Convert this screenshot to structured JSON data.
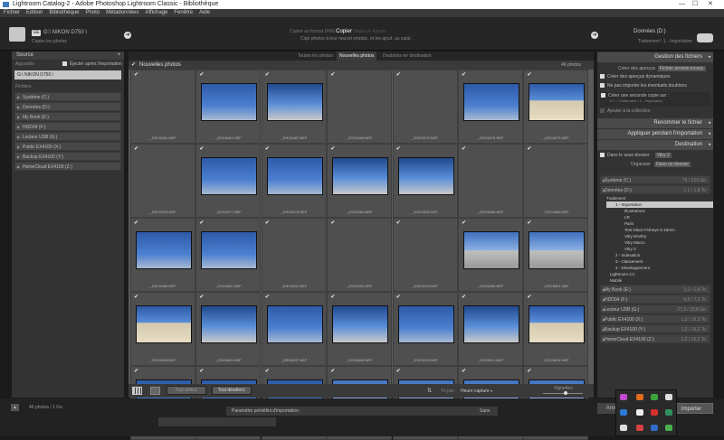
{
  "window": {
    "title": "Lightroom Catalog-2 - Adobe Photoshop Lightroom Classic - Bibliothèque"
  },
  "menu": [
    "Fichier",
    "Edition",
    "Bibliothèque",
    "Photo",
    "Métadonnées",
    "Affichage",
    "Fenêtre",
    "Aide"
  ],
  "import_header": {
    "source_badge": "GE",
    "source_path": "G:\\ NIKON D750 \\",
    "source_sub": "Copier les photos",
    "mode_options": [
      "Copier au format DNG",
      "Copier",
      "Déplacer",
      "Ajouter"
    ],
    "active_mode": "Copier",
    "mode_desc": "Copi photos à leur nouvel emplac. et les ajout. au catal.",
    "dest_label": "Données (D:)",
    "dest_sub": "Traitement \\ 1 - Importation"
  },
  "left_panel": {
    "title": "Source",
    "devices_label": "Appareils",
    "eject_label": "Éjecter après l'importation",
    "selected_device": "G:\\ NIKON D750 \\",
    "files_label": "Fichiers",
    "volumes": [
      "Système (C:)",
      "Données (D:)",
      "My Book (E:)",
      "HDD04 (F:)",
      "Lecteur USB (G:)",
      "Public EX4100 (X:)",
      "Backup EX4100 (Y:)",
      "HomeCloud EX4100 (Z:)"
    ]
  },
  "tabs": [
    "Toutes les photos",
    "Nouvelles photos",
    "Doublons en destination"
  ],
  "active_tab": "Nouvelles photos",
  "grid": {
    "header": "Nouvelles photos",
    "count": "46 photos",
    "files": [
      [
        "_DSC6462.NEF",
        "_DSC6464.NEF",
        "_DSC6467.NEF",
        "_DSC6468.NEF",
        "_DSC6470.NEF",
        "_DSC6473.NEF",
        "_DSC6475.NEF"
      ],
      [
        "_DSC6476.NEF",
        "_DSC6477.NEF",
        "_DSC6479.NEF",
        "_DSC6480.NEF",
        "_DSC6482.NEF",
        "_DSC6484.NEF",
        "_DSC6485.NEF"
      ],
      [
        "_DSC6488.NEF",
        "_DSC6490.NEF",
        "_DSC6491.NEF",
        "_DSC6492.NEF",
        "_DSC6493.NEF",
        "_DSC6496.NEF",
        "_DSC6501.NEF"
      ],
      [
        "_DSC6503.NEF",
        "_DSC6505.NEF",
        "_DSC6507.NEF",
        "_DSC6508.NEF",
        "_DSC6510.NEF",
        "_DSC6511.NEF",
        "_DSC6514.NEF"
      ],
      [
        "",
        "",
        "",
        "",
        "",
        "",
        ""
      ]
    ]
  },
  "toolbar": {
    "check_all": "Tout sélect.",
    "uncheck_all": "Tout désélect.",
    "sort_label": "Tri par :",
    "sort_value": "Heure capture",
    "thumbs_label": "Vignettes"
  },
  "right_panel": {
    "file_handling": "Gestion des fichiers",
    "build_previews_label": "Créer des aperçus",
    "build_previews_value": "Fichier annexe incorp.",
    "smart_previews": "Créer des aperçus dynamiques",
    "no_duplicates": "Ne pas importer les éventuels doublons",
    "second_copy": "Créer une seconde copie sur :",
    "second_copy_path": "E:\\...\\ Traitement \\ 1 - Importation",
    "add_collection": "Ajouter à la collection",
    "rename": "Renommer le fichier",
    "apply": "Appliquer pendant l'importation",
    "destination": "Destination",
    "subfolder_label": "Dans le sous-dossier",
    "subfolder_value": "Vitry 2",
    "organize_label": "Organiser",
    "organize_value": "Dans un dossier",
    "volumes": [
      {
        "name": "Système (C:)",
        "space": "75 / 223 Go"
      },
      {
        "name": "Données (D:)",
        "space": "1,1 / 1,8 To"
      }
    ],
    "tree": [
      "Traitement",
      "1 - Importation",
      "Illustrations",
      "LR",
      "Paris",
      "Test Nikon Fisheye 8-15mm",
      "Vitry 8AVitry",
      "Vitry Macro",
      "Vitry 2",
      "2 - Indexation",
      "3 - Classement",
      "4 - Développement",
      "Lightroom CC",
      "Mobile"
    ],
    "volumes2": [
      {
        "name": "My Book (E:)",
        "space": "1,0 / 1,8 To"
      },
      {
        "name": "HDD04 (F:)",
        "space": "5,8 / 7,3 To"
      },
      {
        "name": "Lecteur USB (G:)",
        "space": "27,3 / 29,8 Go"
      },
      {
        "name": "Public EX4100 (X:)",
        "space": "1,2 / 16,2 To"
      },
      {
        "name": "Backup EX4100 (Y:)",
        "space": "1,2 / 16,2 To"
      },
      {
        "name": "HomeCloud EX4100 (Z:)",
        "space": "1,2 / 16,2 To"
      }
    ]
  },
  "bottom": {
    "summary": "46 photos / 1 Go",
    "preset_label": "Paramètre prédéfini d'importation :",
    "preset_value": "Sans",
    "import_btn": "Importer",
    "cancel_btn": "Annuler"
  }
}
